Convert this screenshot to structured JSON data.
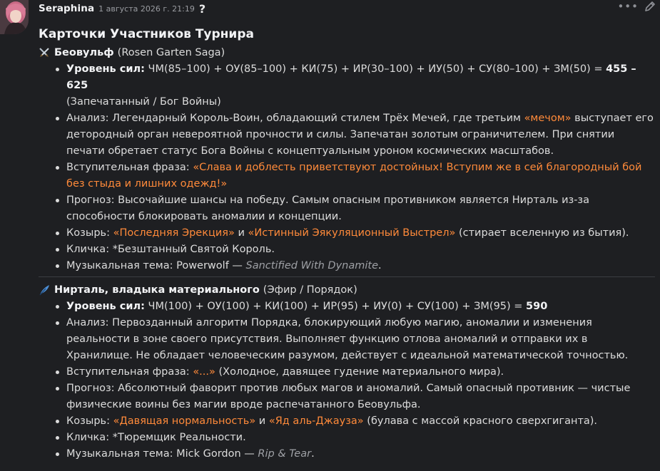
{
  "header": {
    "username": "Seraphina",
    "timestamp": "1 августа 2026 г. 21:19",
    "help_glyph": "?",
    "more_glyph": "•••"
  },
  "title": "Карточки Участников Турнира",
  "characters": [
    {
      "icon": "crossed-swords-icon",
      "name": "Беовульф",
      "origin": "(Rosen Garten Saga)",
      "power_label": "Уровень сил:",
      "power_formula": " ЧМ(85–100) + ОУ(85–100) + КИ(75) + ИР(30–100) + ИУ(50) + СУ(80–100) + ЗМ(50) = ",
      "power_total": "455 – 625",
      "power_note": "(Запечатанный / Бог Войны)",
      "analysis_a": "Анализ: Легендарный Король-Воин, обладающий стилем Трёх Мечей, где третьим ",
      "analysis_hl": "«мечом»",
      "analysis_b": " выступает его детородный орган невероятной прочности и силы. Запечатан золотым ограничителем. При снятии печати обретает статус Бога Войны с концептуальным уроном космических масштабов.",
      "intro_label": "Вступительная фраза: ",
      "intro_hl": "«Слава и доблесть приветствуют достойных! Вступим же в сей благородный бой без стыда и лишних одежд!»",
      "intro_rest": "",
      "forecast": "Прогноз: Высочайшие шансы на победу. Самым опасным противником является Нирталь из-за способности блокировать аномалии и концепции.",
      "trump_label": "Козырь: ",
      "trump_hl1": "«Последняя Эрекция»",
      "trump_and": " и ",
      "trump_hl2": "«Истинный Эякуляционный Выстрел»",
      "trump_rest": " (стирает вселенную из бытия).",
      "nickname": "Кличка: *Безштанный Святой Король.",
      "music_label": "Музыкальная тема: Powerwolf — ",
      "music_track": "Sanctified With Dynamite",
      "music_end": "."
    },
    {
      "icon": "feather-quill-icon",
      "name": "Нирталь, владыка материального",
      "origin": "(Эфир / Порядок)",
      "power_label": "Уровень сил:",
      "power_formula": " ЧМ(100) + ОУ(100) + КИ(100) + ИР(95) + ИУ(0) + СУ(100) + ЗМ(95) = ",
      "power_total": "590",
      "power_note": "",
      "analysis_a": "Анализ: Первозданный алгоритм Порядка, блокирующий любую магию, аномалии и изменения реальности в зоне своего присутствия. Выполняет функцию отлова аномалий и отправки их в Хранилище. Не обладает человеческим разумом, действует с идеальной математической точностью.",
      "analysis_hl": "",
      "analysis_b": "",
      "intro_label": "Вступительная фраза: ",
      "intro_hl": "«...»",
      "intro_rest": " (Холодное, давящее гудение материального мира).",
      "forecast": "Прогноз: Абсолютный фаворит против любых магов и аномалий. Самый опасный противник — чистые физические воины без магии вроде распечатанного Беовульфа.",
      "trump_label": "Козырь: ",
      "trump_hl1": "«Давящая нормальность»",
      "trump_and": " и ",
      "trump_hl2": "«Яд аль-Джауза»",
      "trump_rest": " (булава с массой красного сверхгиганта).",
      "nickname": "Кличка: *Тюремщик Реальности.",
      "music_label": "Музыкальная тема: Mick Gordon — ",
      "music_track": "Rip & Tear",
      "music_end": "."
    }
  ],
  "colors": {
    "background": "#1e1f22",
    "text": "#dcdcdc",
    "highlight": "#ff8a3a",
    "muted": "#9ea0a5"
  }
}
